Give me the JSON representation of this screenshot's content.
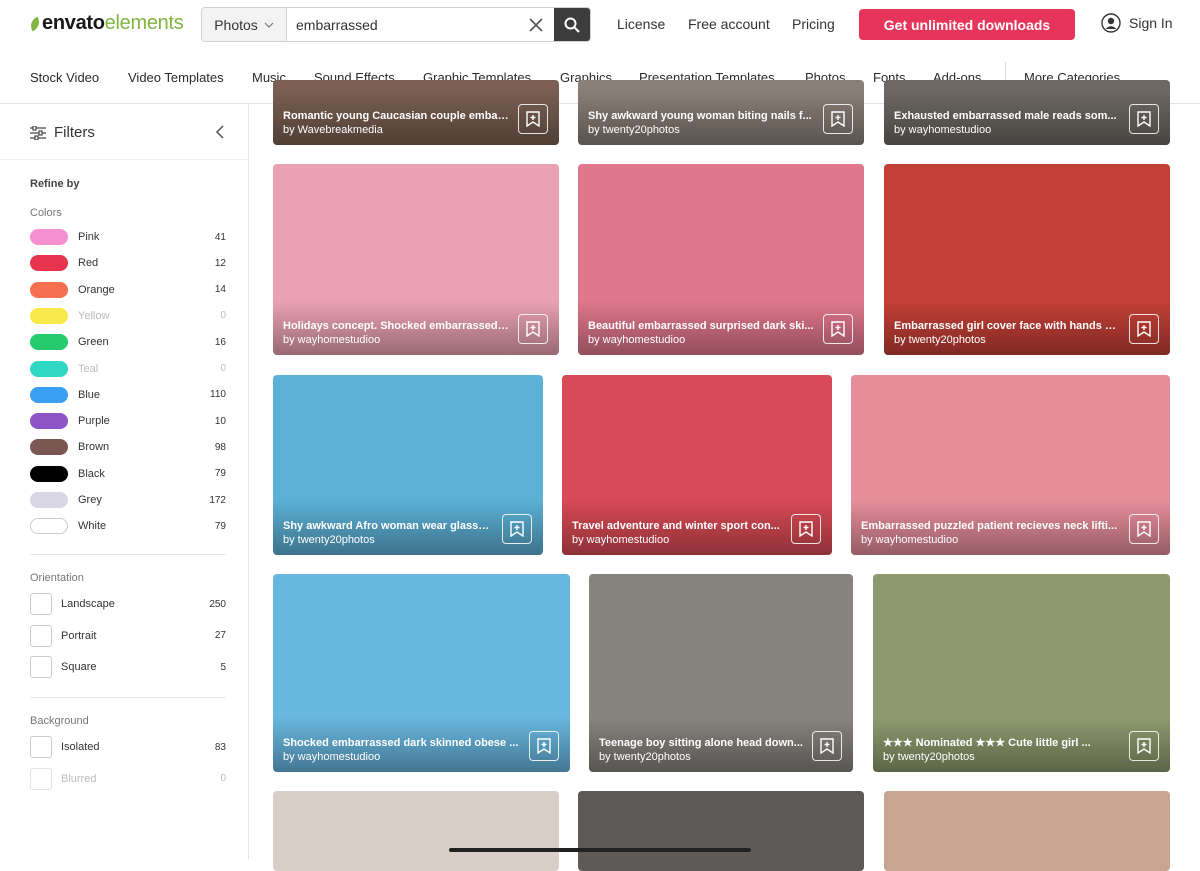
{
  "header": {
    "logo_bold": "envato",
    "logo_light": "elements",
    "search": {
      "category": "Photos",
      "query": "embarrassed"
    },
    "nav": [
      "License",
      "Free account",
      "Pricing"
    ],
    "cta": "Get unlimited downloads",
    "signin": "Sign In"
  },
  "categories": [
    "Stock Video",
    "Video Templates",
    "Music",
    "Sound Effects",
    "Graphic Templates",
    "Graphics",
    "Presentation Templates",
    "Photos",
    "Fonts",
    "Add-ons",
    "More Categories"
  ],
  "sidebar": {
    "title": "Filters",
    "refine": "Refine by",
    "colors_label": "Colors",
    "colors": [
      {
        "name": "Pink",
        "count": "41",
        "hex": "#f48fd0"
      },
      {
        "name": "Red",
        "count": "12",
        "hex": "#e8334f"
      },
      {
        "name": "Orange",
        "count": "14",
        "hex": "#f66f4f"
      },
      {
        "name": "Yellow",
        "count": "0",
        "hex": "#f9e84a"
      },
      {
        "name": "Green",
        "count": "16",
        "hex": "#26cb6e"
      },
      {
        "name": "Teal",
        "count": "0",
        "hex": "#2ed8c3"
      },
      {
        "name": "Blue",
        "count": "110",
        "hex": "#3a9ff0"
      },
      {
        "name": "Purple",
        "count": "10",
        "hex": "#8e55c9"
      },
      {
        "name": "Brown",
        "count": "98",
        "hex": "#7a5752"
      },
      {
        "name": "Black",
        "count": "79",
        "hex": "#000000"
      },
      {
        "name": "Grey",
        "count": "172",
        "hex": "#d9d7e5"
      },
      {
        "name": "White",
        "count": "79",
        "hex": "#ffffff"
      }
    ],
    "orientation_label": "Orientation",
    "orientation": [
      {
        "name": "Landscape",
        "count": "250"
      },
      {
        "name": "Portrait",
        "count": "27"
      },
      {
        "name": "Square",
        "count": "5"
      }
    ],
    "background_label": "Background",
    "background": [
      {
        "name": "Isolated",
        "count": "83"
      },
      {
        "name": "Blurred",
        "count": "0"
      }
    ]
  },
  "results": [
    {
      "title": "Romantic young Caucasian couple embar...",
      "author": "by Wavebreakmedia",
      "bg": "#7a5f52"
    },
    {
      "title": "Shy awkward young woman biting nails f...",
      "author": "by twenty20photos",
      "bg": "#8a7f77"
    },
    {
      "title": "Exhausted embarrassed male reads som...",
      "author": "by wayhomestudioo",
      "bg": "#6d6863"
    },
    {
      "title": "Holidays concept. Shocked embarrassed ...",
      "author": "by wayhomestudioo",
      "bg": "#eaa2b2"
    },
    {
      "title": "Beautiful embarrassed surprised dark ski...",
      "author": "by wayhomestudioo",
      "bg": "#e0778c"
    },
    {
      "title": "Embarrassed girl cover face with hands c...",
      "author": "by twenty20photos",
      "bg": "#c44037"
    },
    {
      "title": "Shy awkward Afro woman wear glasse...",
      "author": "by twenty20photos",
      "bg": "#5cb0d6"
    },
    {
      "title": "Travel adventure and winter sport con...",
      "author": "by wayhomestudioo",
      "bg": "#d84a55"
    },
    {
      "title": "Embarrassed puzzled patient recieves neck lifti...",
      "author": "by wayhomestudioo",
      "bg": "#e58d9b"
    },
    {
      "title": "Shocked embarrassed dark skinned obese ...",
      "author": "by wayhomestudioo",
      "bg": "#68b7e0"
    },
    {
      "title": "Teenage boy sitting alone head down...",
      "author": "by twenty20photos",
      "bg": "#87837e"
    },
    {
      "title": "★★★ Nominated ★★★ Cute little girl ...",
      "author": "by twenty20photos",
      "bg": "#8e9a6e"
    },
    {
      "title": "",
      "author": "",
      "bg": "#d9cfc8"
    },
    {
      "title": "",
      "author": "",
      "bg": "#5d5a58"
    },
    {
      "title": "",
      "author": "",
      "bg": "#c9a490"
    }
  ]
}
